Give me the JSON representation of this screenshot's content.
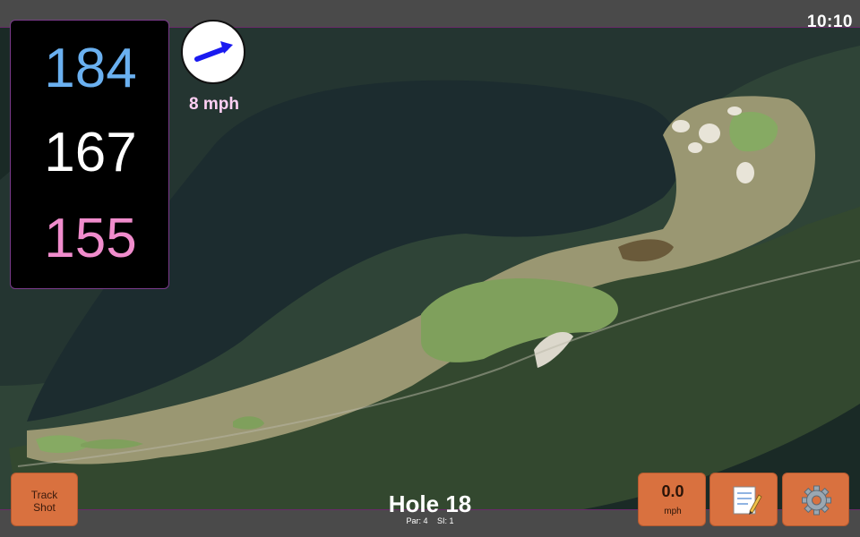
{
  "status": {
    "time": "10:10"
  },
  "distances": {
    "back": "184",
    "middle": "167",
    "front": "155"
  },
  "wind": {
    "speed": "8 mph",
    "direction_icon": "arrow-northeast-icon",
    "arrow_color": "#1a1af0"
  },
  "buttons": {
    "track_shot_line1": "Track",
    "track_shot_line2": "Shot",
    "speed_value": "0.0",
    "speed_unit": "mph",
    "notes_icon": "memo-icon",
    "settings_icon": "gear-icon"
  },
  "hole": {
    "title": "Hole 18",
    "par": "Par: 4",
    "si": "SI: 1"
  },
  "colors": {
    "back_distance": "#6ab0f0",
    "middle_distance": "#ffffff",
    "front_distance": "#f08ccc",
    "button_bg": "#d9713f",
    "bar_bg": "#4a4a4a"
  }
}
